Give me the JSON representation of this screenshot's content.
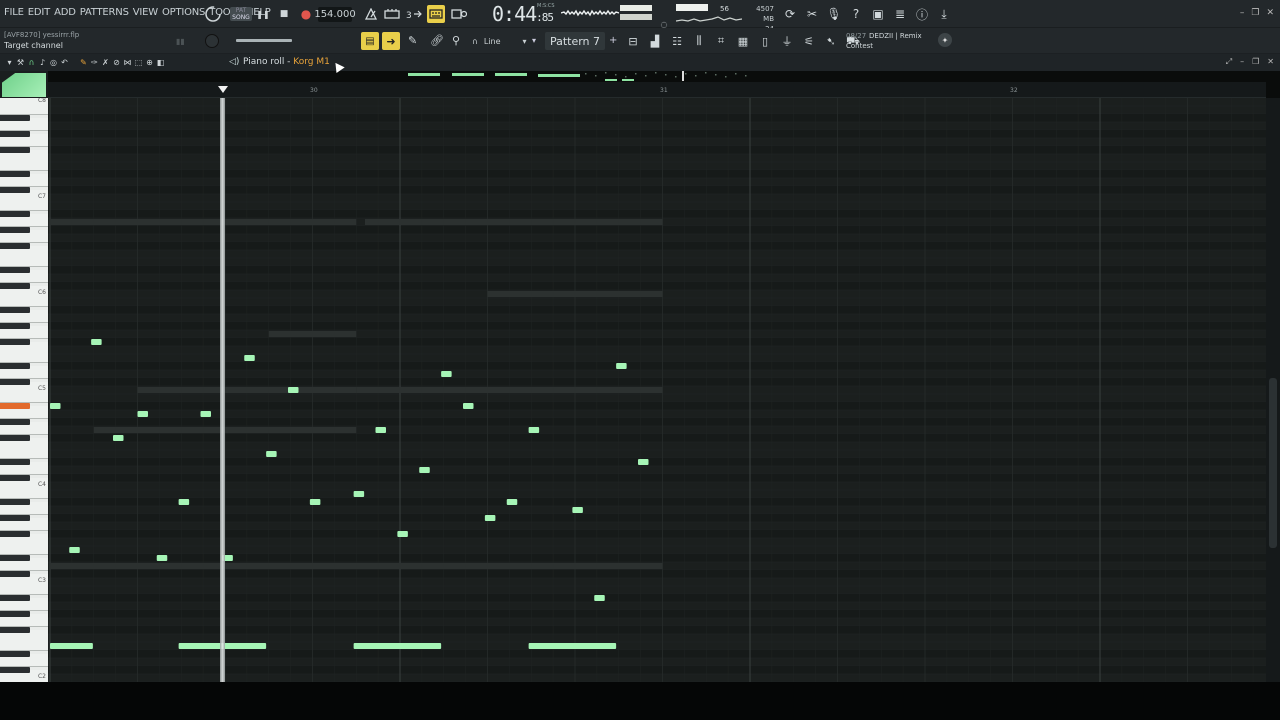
{
  "menu": [
    "FILE",
    "EDIT",
    "ADD",
    "PATTERNS",
    "VIEW",
    "OPTIONS",
    "TOOLS",
    "HELP"
  ],
  "transport": {
    "mode_top": "PAT",
    "mode_bottom": "SONG",
    "pause": "❚❚",
    "stop": "■",
    "record": "●",
    "tempo": "154.000"
  },
  "time": {
    "main": "0:44",
    "sub": ":85",
    "unit": "M:S:CS"
  },
  "cpu": {
    "value": "56"
  },
  "memory": {
    "ram": "4507 MB",
    "voices": "24"
  },
  "project": {
    "file": "[AVF8270] yessirrr.flp",
    "hint": "Target channel"
  },
  "snap": {
    "label": "Line"
  },
  "pattern": {
    "name": "Pattern 7",
    "add": "+"
  },
  "news": {
    "date": "08/27",
    "title": "DEDZII | Remix",
    "subtitle": "Contest"
  },
  "piano_roll": {
    "title": "Piano roll - ",
    "instrument": "Korg M1"
  },
  "ruler": {
    "bars": [
      "30",
      "31",
      "32"
    ]
  },
  "octaves": [
    "C8",
    "C7",
    "C6",
    "C5",
    "C4",
    "C3",
    "C2"
  ],
  "notes": [
    {
      "start": 0.0,
      "len": 0.12,
      "pitch": 70,
      "color": "#a6f5b6"
    },
    {
      "start": 0.22,
      "len": 0.12,
      "pitch": 52,
      "color": "#a6f5b6"
    },
    {
      "start": 0.47,
      "len": 0.12,
      "pitch": 78,
      "color": "#a6f5b6"
    },
    {
      "start": 0.72,
      "len": 0.12,
      "pitch": 66,
      "color": "#a6f5b6"
    },
    {
      "start": 0.0,
      "len": 0.49,
      "pitch": 40,
      "color": "#a6f5b6"
    },
    {
      "start": 1.0,
      "len": 0.12,
      "pitch": 69,
      "color": "#a6f5b6"
    },
    {
      "start": 1.22,
      "len": 0.12,
      "pitch": 51,
      "color": "#a6f5b6"
    },
    {
      "start": 1.47,
      "len": 0.12,
      "pitch": 58,
      "color": "#a6f5b6"
    },
    {
      "start": 1.72,
      "len": 0.12,
      "pitch": 69,
      "color": "#a6f5b6"
    },
    {
      "start": 1.47,
      "len": 1.0,
      "pitch": 40,
      "color": "#a6f5b6"
    },
    {
      "start": 1.97,
      "len": 0.12,
      "pitch": 51,
      "color": "#a6f5b6"
    },
    {
      "start": 2.22,
      "len": 0.12,
      "pitch": 76,
      "color": "#a6f5b6"
    },
    {
      "start": 2.47,
      "len": 0.12,
      "pitch": 64,
      "color": "#a6f5b6"
    },
    {
      "start": 2.72,
      "len": 0.12,
      "pitch": 72,
      "color": "#a6f5b6"
    },
    {
      "start": 2.97,
      "len": 0.12,
      "pitch": 58,
      "color": "#a6f5b6"
    },
    {
      "start": 3.47,
      "len": 0.12,
      "pitch": 59,
      "color": "#a6f5b6"
    },
    {
      "start": 3.72,
      "len": 0.12,
      "pitch": 67,
      "color": "#a6f5b6"
    },
    {
      "start": 3.47,
      "len": 1.0,
      "pitch": 40,
      "color": "#a6f5b6"
    },
    {
      "start": 3.97,
      "len": 0.12,
      "pitch": 54,
      "color": "#a6f5b6"
    },
    {
      "start": 4.22,
      "len": 0.12,
      "pitch": 62,
      "color": "#a6f5b6"
    },
    {
      "start": 4.47,
      "len": 0.12,
      "pitch": 74,
      "color": "#a6f5b6"
    },
    {
      "start": 4.72,
      "len": 0.12,
      "pitch": 70,
      "color": "#a6f5b6"
    },
    {
      "start": 4.97,
      "len": 0.12,
      "pitch": 56,
      "color": "#a6f5b6"
    },
    {
      "start": 5.22,
      "len": 0.12,
      "pitch": 58,
      "color": "#a6f5b6"
    },
    {
      "start": 5.47,
      "len": 0.12,
      "pitch": 67,
      "color": "#a6f5b6"
    },
    {
      "start": 5.47,
      "len": 1.0,
      "pitch": 40,
      "color": "#a6f5b6"
    },
    {
      "start": 5.97,
      "len": 0.12,
      "pitch": 57,
      "color": "#a6f5b6"
    },
    {
      "start": 6.22,
      "len": 0.12,
      "pitch": 46,
      "color": "#a6f5b6"
    },
    {
      "start": 6.47,
      "len": 0.12,
      "pitch": 75,
      "color": "#a6f5b6"
    },
    {
      "start": 6.72,
      "len": 0.12,
      "pitch": 63,
      "color": "#a6f5b6"
    }
  ],
  "ghost_notes": [
    {
      "start": 0.0,
      "len": 3.5,
      "pitch": 93
    },
    {
      "start": 3.6,
      "len": 3.4,
      "pitch": 93
    },
    {
      "start": 2.5,
      "len": 1.0,
      "pitch": 79
    },
    {
      "start": 0.0,
      "len": 7.0,
      "pitch": 50
    },
    {
      "start": 1.0,
      "len": 2.5,
      "pitch": 72
    },
    {
      "start": 3.5,
      "len": 3.5,
      "pitch": 72
    },
    {
      "start": 0.5,
      "len": 3.0,
      "pitch": 67
    },
    {
      "start": 0.5,
      "len": 0.5,
      "pitch": 35
    },
    {
      "start": 2.0,
      "len": 2.0,
      "pitch": 35
    },
    {
      "start": 4.5,
      "len": 1.5,
      "pitch": 35
    },
    {
      "start": 5.0,
      "len": 2.0,
      "pitch": 84
    }
  ],
  "colors": {
    "note": "#a6f5b6",
    "ghost": "#2c3130",
    "grid_bg": "#1b1f1e",
    "accent": "#e9cf4a"
  }
}
